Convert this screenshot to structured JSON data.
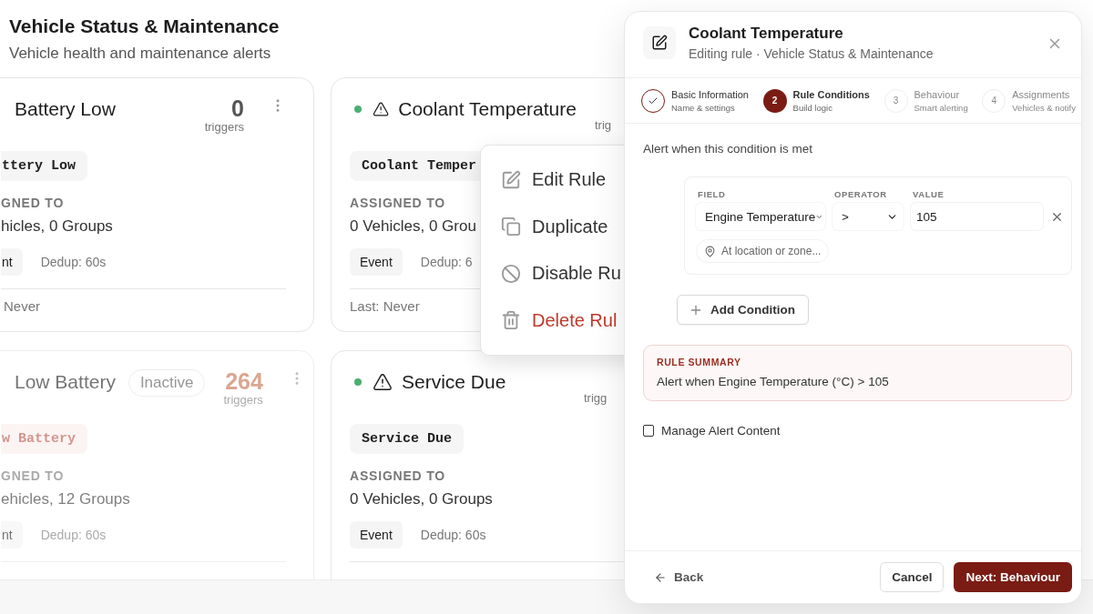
{
  "page": {
    "title": "Vehicle Status & Maintenance",
    "subtitle": "Vehicle health and maintenance alerts"
  },
  "cards": [
    {
      "title": "Battery Low",
      "count": "0",
      "count_label": "triggers",
      "chip": "ttery Low",
      "assigned_label": "GNED TO",
      "assigned": "hicles, 0 Groups",
      "type": "nt",
      "dedup": "Dedup: 60s",
      "last": "Never",
      "inactive": false
    },
    {
      "color": "#4caf72",
      "title": "Coolant Temperature",
      "count_label": "trig",
      "chip": "Coolant Temper",
      "assigned_label": "ASSIGNED TO",
      "assigned": "0 Vehicles, 0 Grou",
      "type": "Event",
      "dedup": "Dedup: 6",
      "last": "Last: Never",
      "inactive": false
    },
    {
      "title": "Low Battery",
      "badge": "Inactive",
      "count": "264",
      "count_label": "triggers",
      "chip": "w Battery",
      "assigned_label": "GNED TO",
      "assigned": "ehicles, 12 Groups",
      "type": "nt",
      "dedup": "Dedup: 60s",
      "inactive": true
    },
    {
      "color": "#4caf72",
      "title": "Service Due",
      "count_label": "trigg",
      "chip": "Service Due",
      "assigned_label": "ASSIGNED TO",
      "assigned": "0 Vehicles, 0 Groups",
      "type": "Event",
      "dedup": "Dedup: 60s",
      "inactive": false
    }
  ],
  "context_menu": {
    "items": [
      {
        "kind": "edit",
        "label": "Edit Rule"
      },
      {
        "kind": "duplicate",
        "label": "Duplicate"
      },
      {
        "kind": "disable",
        "label": "Disable Ru"
      },
      {
        "kind": "delete",
        "label": "Delete Rul"
      }
    ]
  },
  "dialog": {
    "title": "Coolant Temperature",
    "subtitle": "Editing rule · Vehicle Status & Maintenance",
    "steps": [
      {
        "title": "Basic Information",
        "caption": "Name & settings",
        "completed": true,
        "selected": false
      },
      {
        "number": "2",
        "title": "Rule Conditions",
        "caption": "Build logic",
        "completed": false,
        "selected": true
      },
      {
        "number": "3",
        "title": "Behaviour",
        "caption": "Smart alerting",
        "completed": false,
        "selected": false
      },
      {
        "number": "4",
        "title": "Assignments",
        "caption": "Vehicles & notify",
        "completed": false,
        "selected": false
      }
    ],
    "intro": "Alert when this condition is met",
    "condition": {
      "field_label": "FIELD",
      "field": "Engine Temperature",
      "operator_label": "OPERATOR",
      "operator": ">",
      "value_label": "VALUE",
      "value": "105",
      "location_placeholder": "At location or zone..."
    },
    "add_condition": "Add Condition",
    "summary": {
      "label": "RULE SUMMARY",
      "text": "Alert when Engine Temperature (°C) > 105"
    },
    "manage_content": {
      "label": "Manage Alert Content",
      "checked": false
    },
    "back": "Back",
    "cancel": "Cancel",
    "next": "Next: Behaviour"
  }
}
